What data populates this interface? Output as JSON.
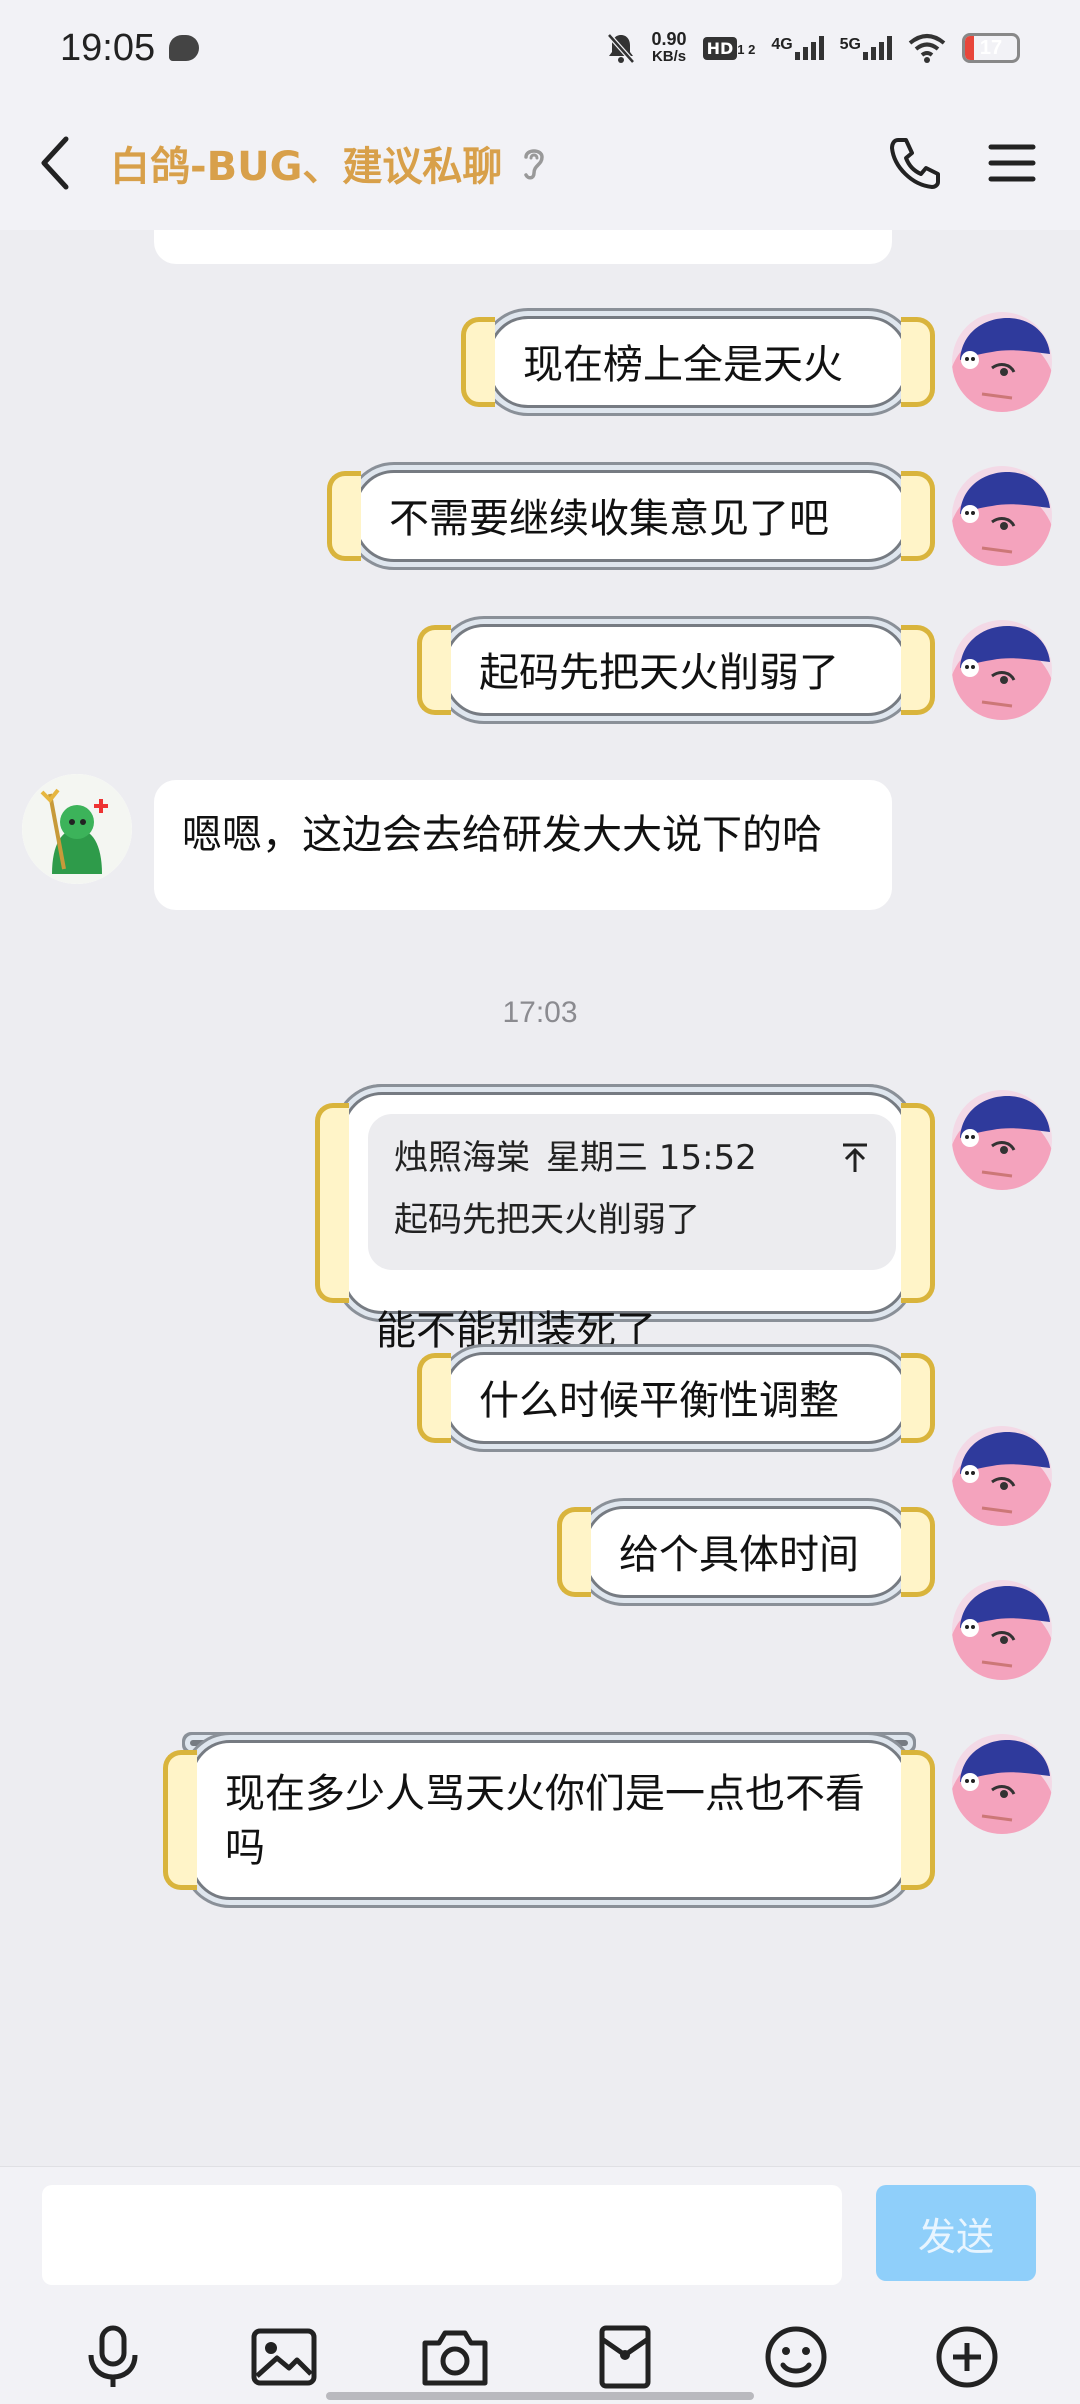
{
  "status_bar": {
    "time": "19:05",
    "net_speed_value": "0.90",
    "net_speed_unit": "KB/s",
    "hd_label": "HD",
    "hd_sub": "1 2",
    "sig1": "4G",
    "sig2": "5G",
    "battery": "17",
    "battery_level": 0.17
  },
  "header": {
    "title": "白鸽-BUG、建议私聊"
  },
  "messages": {
    "m1": "现在榜上全是天火",
    "m2": "不需要继续收集意见了吧",
    "m3": "起码先把天火削弱了",
    "m4": "嗯嗯，这边会去给研发大大说下的哈",
    "timestamp": "17:03",
    "quote_author": "烛照海棠",
    "quote_time": "星期三 15:52",
    "quote_text": "起码先把天火削弱了",
    "m5": "能不能别装死了",
    "m6": "什么时候平衡性调整",
    "m7": "给个具体时间",
    "m8": "现在多少人骂天火你们是一点也不看吗"
  },
  "input": {
    "send_label": "发送",
    "placeholder": ""
  },
  "toolbar": {
    "icons": [
      "microphone-icon",
      "image-icon",
      "camera-icon",
      "red-packet-icon",
      "emoji-icon",
      "plus-icon"
    ]
  },
  "colors": {
    "title": "#d8a04a",
    "send_button": "#8fcffa",
    "background": "#ededf1"
  }
}
